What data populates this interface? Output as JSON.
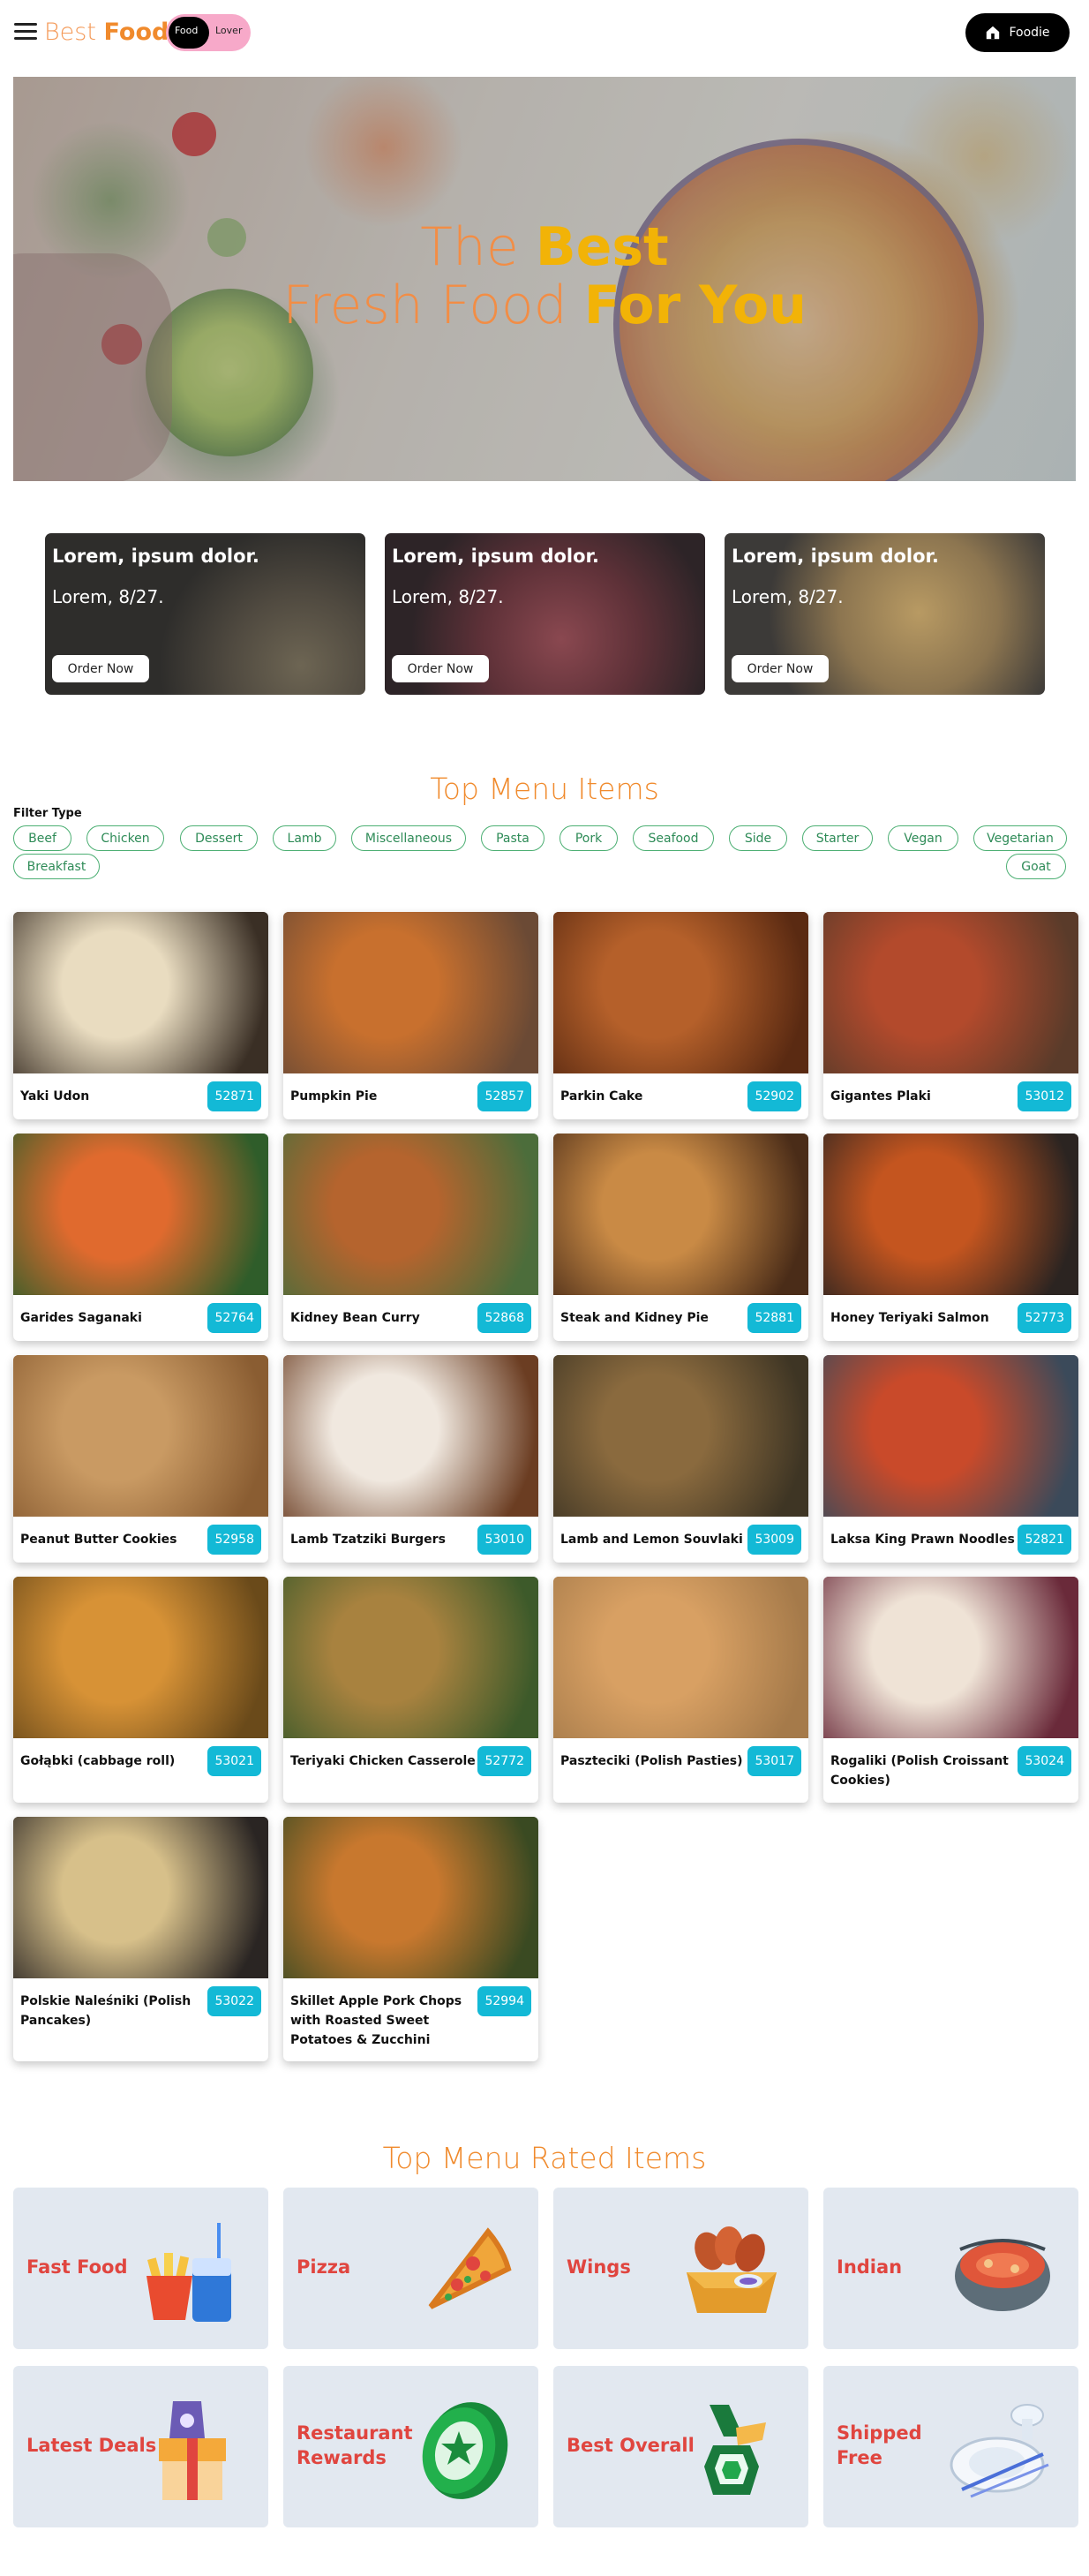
{
  "header": {
    "brand_light": "Best",
    "brand_bold": "Foods",
    "toggle_on": "Food",
    "toggle_off": "Lover",
    "cta": "Foodie"
  },
  "hero": {
    "line1_light": "The",
    "line1_bold": "Best",
    "line2_light": "Fresh Food",
    "line2_bold": "For You"
  },
  "promos": [
    {
      "title": "Lorem, ipsum dolor.",
      "subtitle": "Lorem, 8/27.",
      "button": "Order Now"
    },
    {
      "title": "Lorem, ipsum dolor.",
      "subtitle": "Lorem, 8/27.",
      "button": "Order Now"
    },
    {
      "title": "Lorem, ipsum dolor.",
      "subtitle": "Lorem, 8/27.",
      "button": "Order Now"
    }
  ],
  "menu": {
    "title": "Top Menu Items",
    "filter_label": "Filter Type",
    "filters": [
      "Beef",
      "Chicken",
      "Dessert",
      "Lamb",
      "Miscellaneous",
      "Pasta",
      "Pork",
      "Seafood",
      "Side",
      "Starter",
      "Vegan",
      "Vegetarian",
      "Breakfast",
      "Goat"
    ],
    "items": [
      {
        "name": "Yaki Udon",
        "id": "52871",
        "colors": [
          "#e9dcc0",
          "#3a2f25"
        ]
      },
      {
        "name": "Pumpkin Pie",
        "id": "52857",
        "colors": [
          "#c8702e",
          "#6b4a35"
        ]
      },
      {
        "name": "Parkin Cake",
        "id": "52902",
        "colors": [
          "#b5602a",
          "#5a2a12"
        ]
      },
      {
        "name": "Gigantes Plaki",
        "id": "53012",
        "colors": [
          "#b34a2c",
          "#5a3b2a"
        ]
      },
      {
        "name": "Garides Saganaki",
        "id": "52764",
        "colors": [
          "#e06a2e",
          "#2f5d2a"
        ]
      },
      {
        "name": "Kidney Bean Curry",
        "id": "52868",
        "colors": [
          "#b5642e",
          "#4c6d3b"
        ]
      },
      {
        "name": "Steak and Kidney Pie",
        "id": "52881",
        "colors": [
          "#c98a45",
          "#4a2c18"
        ]
      },
      {
        "name": "Honey Teriyaki Salmon",
        "id": "52773",
        "colors": [
          "#c4551f",
          "#2b2421"
        ]
      },
      {
        "name": "Peanut Butter Cookies",
        "id": "52958",
        "colors": [
          "#c99a63",
          "#8a5d32"
        ]
      },
      {
        "name": "Lamb Tzatziki Burgers",
        "id": "53010",
        "colors": [
          "#f0e8df",
          "#6b3d22"
        ]
      },
      {
        "name": "Lamb and Lemon Souvlaki",
        "id": "53009",
        "colors": [
          "#8a6a3e",
          "#3e3524"
        ]
      },
      {
        "name": "Laksa King Prawn Noodles",
        "id": "52821",
        "colors": [
          "#c94a2a",
          "#3b4a5a"
        ]
      },
      {
        "name": "Gołąbki (cabbage roll)",
        "id": "53021",
        "colors": [
          "#d79236",
          "#6a4a1a"
        ]
      },
      {
        "name": "Teriyaki Chicken Casserole",
        "id": "52772",
        "colors": [
          "#a8823f",
          "#3d5a2a"
        ]
      },
      {
        "name": "Paszteciki (Polish Pasties)",
        "id": "53017",
        "colors": [
          "#d8a063",
          "#a57a4a"
        ]
      },
      {
        "name": "Rogaliki (Polish Croissant Cookies)",
        "id": "53024",
        "colors": [
          "#efe3d6",
          "#6a2a3a"
        ]
      },
      {
        "name": "Polskie Naleśniki (Polish Pancakes)",
        "id": "53022",
        "colors": [
          "#d7c08a",
          "#2a2523"
        ]
      },
      {
        "name": "Skillet Apple Pork Chops with Roasted Sweet Potatoes & Zucchini",
        "id": "52994",
        "colors": [
          "#c8782e",
          "#3a4a22"
        ]
      }
    ]
  },
  "rated": {
    "title": "Top Menu Rated Items",
    "items": [
      {
        "label": "Fast Food",
        "icon": "fast-food-icon"
      },
      {
        "label": "Pizza",
        "icon": "pizza-icon"
      },
      {
        "label": "Wings",
        "icon": "wings-icon"
      },
      {
        "label": "Indian",
        "icon": "indian-curry-icon"
      },
      {
        "label": "Latest Deals",
        "icon": "deals-box-icon"
      },
      {
        "label": "Restaurant Rewards",
        "icon": "rewards-coin-icon"
      },
      {
        "label": "Best Overall",
        "icon": "best-overall-icon"
      },
      {
        "label": "Shipped Free",
        "icon": "shipped-plates-icon"
      }
    ]
  },
  "colors": {
    "brand_orange": "#f08a2c",
    "hero_yellow": "#f2b307",
    "chip_green": "#4caf73",
    "badge_cyan": "#13b9d6",
    "category_red": "#e0453f",
    "category_bg": "#e2e8f0"
  }
}
